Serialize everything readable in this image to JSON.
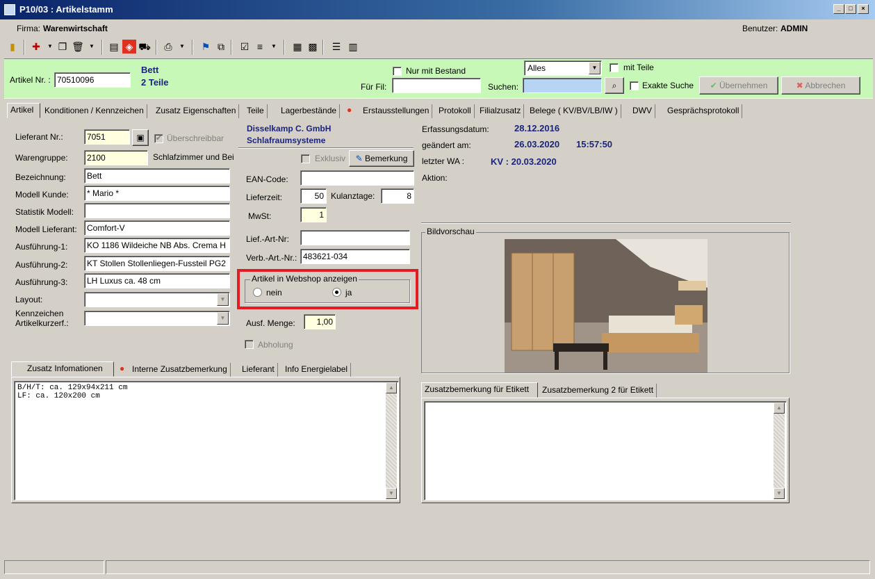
{
  "window": {
    "title": "P10/03 : Artikelstamm",
    "min": "_",
    "max": "□",
    "close": "×"
  },
  "header": {
    "firma_label": "Firma:",
    "firma_value": "Warenwirtschaft",
    "benutzer_label": "Benutzer:",
    "benutzer_value": "ADMIN"
  },
  "search": {
    "artikel_nr_label": "Artikel Nr. :",
    "artikel_nr_value": "70510096",
    "artikel_name": "Bett",
    "artikel_teile": "2 Teile",
    "nur_mit_bestand_label": "Nur mit Bestand",
    "fuer_fil_label": "Für Fil:",
    "fuer_fil_value": "",
    "alles_option": "Alles",
    "suchen_label": "Suchen:",
    "suchen_value": "",
    "mit_teile_label": "mit Teile",
    "exakte_suche_label": "Exakte Suche",
    "uebernehmen_label": "Übernehmen",
    "abbrechen_label": "Abbrechen"
  },
  "tabs": [
    "Artikel",
    "Konditionen / Kennzeichen",
    "Zusatz Eigenschaften",
    "Teile",
    "Lagerbestände",
    "Erstausstellungen",
    "Protokoll",
    "Filialzusatz",
    "Belege ( KV/BV/LB/IW )",
    "DWV",
    "Gesprächsprotokoll"
  ],
  "form": {
    "lieferant_nr_label": "Lieferant Nr.:",
    "lieferant_nr_value": "7051",
    "ueberschreibbar_label": "Überschreibbar",
    "warengruppe_label": "Warengruppe:",
    "warengruppe_value": "2100",
    "warengruppe_text": "Schlafzimmer und Bei",
    "bezeichnung_label": "Bezeichnung:",
    "bezeichnung_value": "Bett",
    "modell_kunde_label": "Modell Kunde:",
    "modell_kunde_value": "* Mario *",
    "statistik_modell_label": "Statistik Modell:",
    "statistik_modell_value": "",
    "modell_lieferant_label": "Modell Lieferant:",
    "modell_lieferant_value": "Comfort-V",
    "ausfuehrung1_label": "Ausführung-1:",
    "ausfuehrung1_value": "KO 1186 Wildeiche NB Abs. Crema H",
    "ausfuehrung2_label": "Ausführung-2:",
    "ausfuehrung2_value": "KT Stollen Stollenliegen-Fussteil PG2",
    "ausfuehrung3_label": "Ausführung-3:",
    "ausfuehrung3_value": "LH Luxus ca. 48 cm",
    "layout_label": "Layout:",
    "kennzeichen_label_1": "Kennzeichen",
    "kennzeichen_label_2": "Artikelkurzerf.:"
  },
  "supplier": {
    "name": "Disselkamp C. GmbH",
    "subtitle": "Schlafraumsysteme"
  },
  "middle": {
    "exklusiv_label": "Exklusiv",
    "bemerkung_label": "Bemerkung",
    "ean_label": "EAN-Code:",
    "ean_value": "",
    "lieferzeit_label": "Lieferzeit:",
    "lieferzeit_value": "50",
    "kulanztage_label": "Kulanztage:",
    "kulanztage_value": "8",
    "mwst_label": "MwSt:",
    "mwst_value": "1",
    "lief_art_label": "Lief.-Art-Nr:",
    "lief_art_value": "",
    "verb_art_label": "Verb.-Art.-Nr.:",
    "verb_art_value": "483621-034",
    "webshop_title": "Artikel in Webshop anzeigen",
    "webshop_nein": "nein",
    "webshop_ja": "ja",
    "ausf_menge_label": "Ausf. Menge:",
    "ausf_menge_value": "1,00",
    "abholung_label": "Abholung"
  },
  "info": {
    "erfassungsdatum_label": "Erfassungsdatum:",
    "erfassungsdatum_value": "28.12.2016",
    "geaendert_label": "geändert am:",
    "geaendert_date": "26.03.2020",
    "geaendert_time": "15:57:50",
    "letzter_wa_label": "letzter WA :",
    "letzter_wa_value": "KV : 20.03.2020",
    "aktion_label": "Aktion:"
  },
  "bildvorschau_label": "Bildvorschau",
  "bottom_tabs_left": [
    "Zusatz Infomationen",
    "Interne Zusatzbemerkung",
    "Lieferant",
    "Info Energielabel"
  ],
  "zusatz_text": "B/H/T: ca. 129x94x211 cm\nLF: ca. 120x200 cm",
  "bottom_tabs_right": [
    "Zusatzbemerkung für Etikett",
    "Zusatzbemerkung 2 für Etikett"
  ],
  "colors": {
    "title_bar": "#0a246a",
    "search_bar": "#c8f8b8",
    "highlight": "#e31b23",
    "label_blue": "#1a237e"
  }
}
